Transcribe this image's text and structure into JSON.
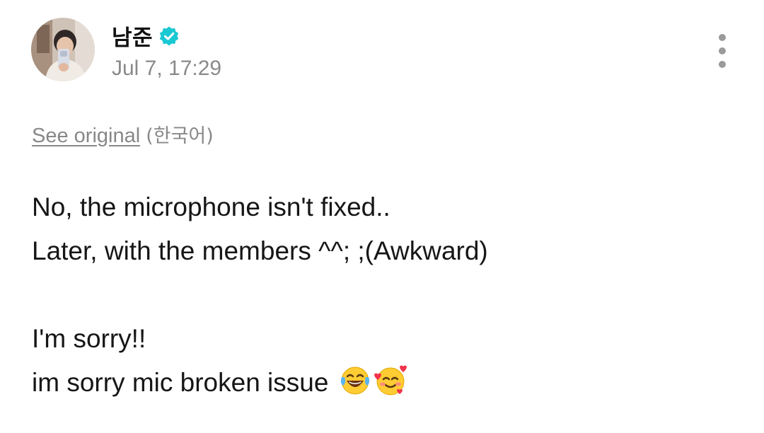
{
  "author": {
    "name": "남준",
    "verified_icon": "verified-badge-icon",
    "verified_color": "#19c8d2"
  },
  "timestamp": "Jul 7, 17:29",
  "translation": {
    "see_original": "See original",
    "language": "(한국어)"
  },
  "body_lines": [
    "No, the microphone isn't fixed..",
    "Later, with the members ^^; ;(Awkward)",
    "",
    "I'm sorry!!",
    "im sorry mic broken issue"
  ],
  "emojis": [
    "face-with-tears-of-joy-icon",
    "smiling-face-with-hearts-icon"
  ],
  "more_menu_icon": "more-vertical-icon"
}
